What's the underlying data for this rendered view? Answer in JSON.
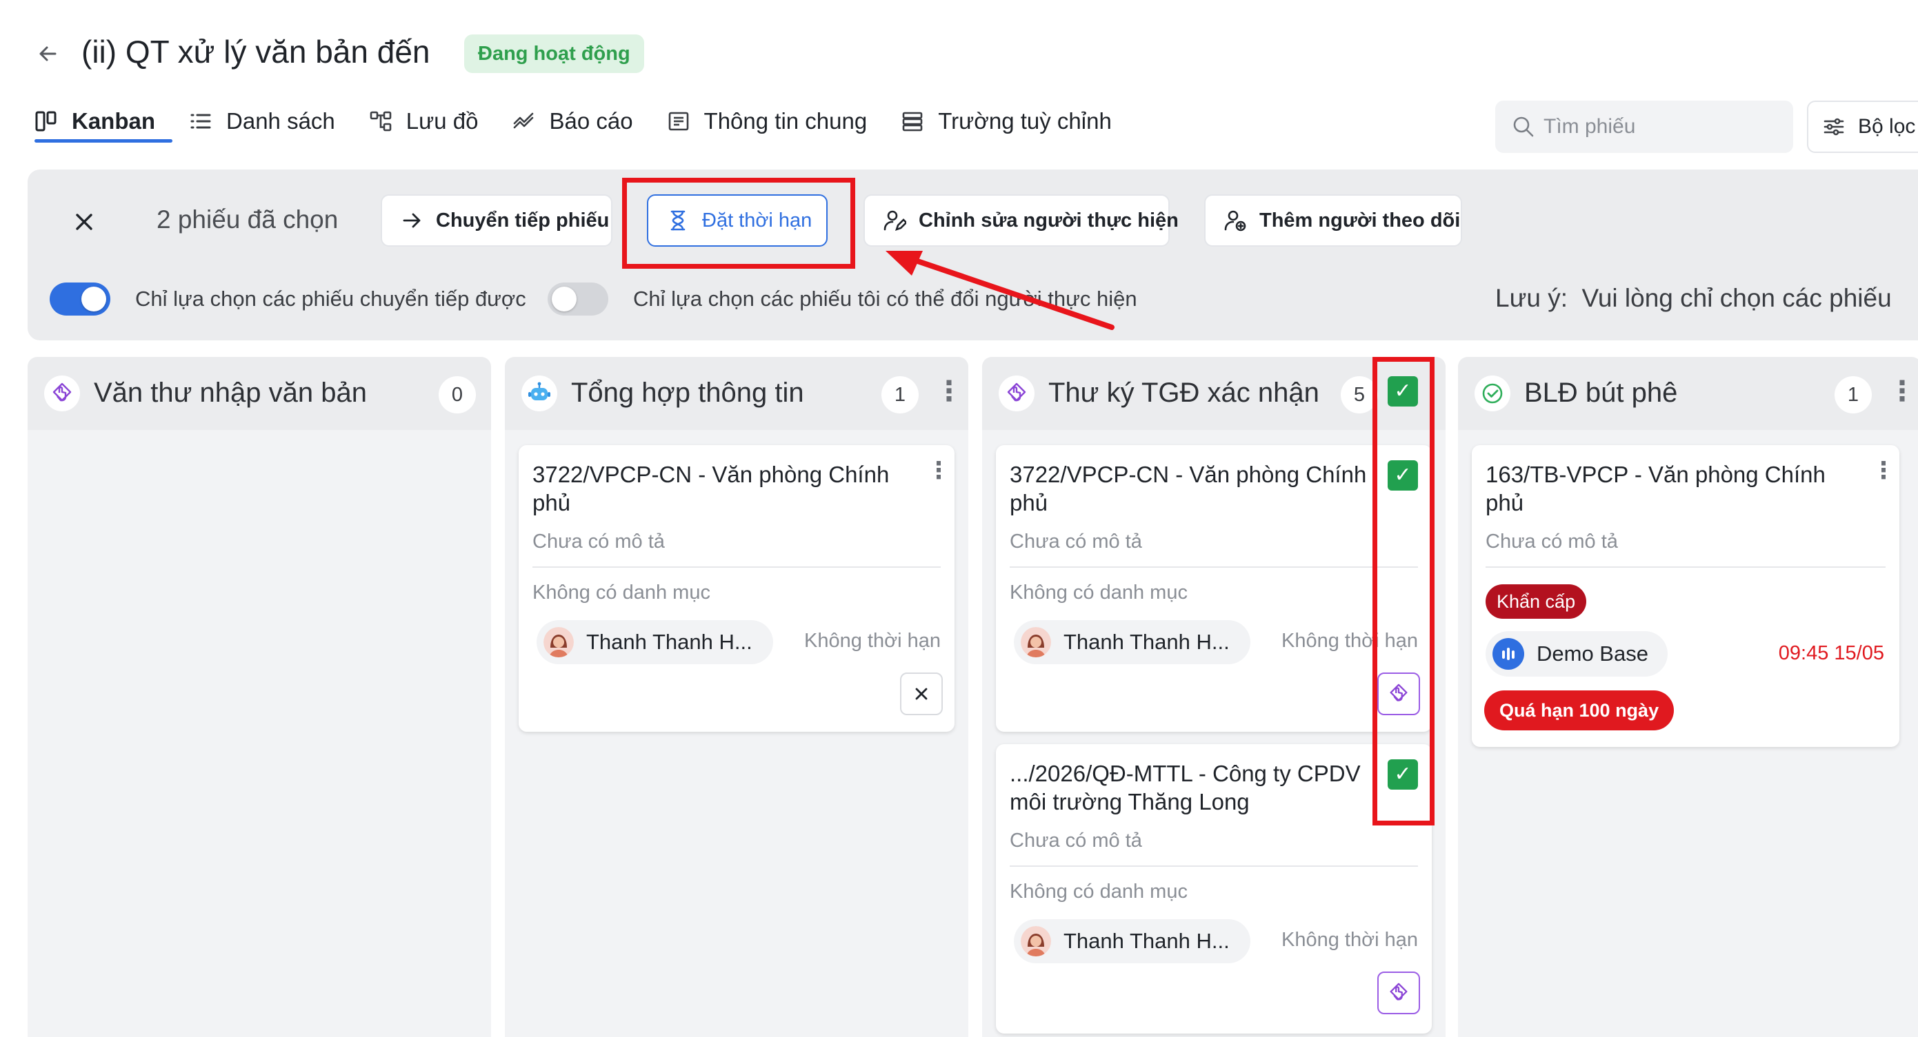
{
  "header": {
    "back_icon": "arrow-left-icon",
    "title": "(ii) QT xử lý văn bản đến",
    "status": "Đang hoạt động",
    "status_color": "#2f9f4d"
  },
  "tabs": [
    {
      "label": "Kanban",
      "icon": "kanban-icon",
      "active": true
    },
    {
      "label": "Danh sách",
      "icon": "list-icon"
    },
    {
      "label": "Lưu đồ",
      "icon": "flowchart-icon"
    },
    {
      "label": "Báo cáo",
      "icon": "report-icon"
    },
    {
      "label": "Thông tin chung",
      "icon": "info-icon"
    },
    {
      "label": "Trường tuỳ chỉnh",
      "icon": "custom-fields-icon"
    }
  ],
  "search": {
    "placeholder": "Tìm phiếu"
  },
  "filter": {
    "label": "Bộ lọc"
  },
  "selection": {
    "count_text": "2 phiếu đã chọn",
    "actions": [
      {
        "label": "Chuyển tiếp phiếu",
        "icon": "arrow-right-icon"
      },
      {
        "label": "Đặt thời hạn",
        "icon": "hourglass-icon",
        "primary": true
      },
      {
        "label": "Chỉnh sửa người thực hiện",
        "icon": "user-edit-icon"
      },
      {
        "label": "Thêm người theo dõi",
        "icon": "user-follow-icon"
      }
    ],
    "toggle1": {
      "label": "Chỉ lựa chọn các phiếu chuyển tiếp được",
      "on": true
    },
    "toggle2": {
      "label": "Chỉ lựa chọn các phiếu tôi có thể đổi người thực hiện",
      "on": false
    },
    "note_label": "Lưu ý:",
    "note_text": "Vui lòng chỉ chọn các phiếu"
  },
  "accent_color": "#2f6fe0",
  "annotation_color": "#e8151b",
  "columns": [
    {
      "title": "Văn thư nhập văn bản",
      "count": "0",
      "icon": "step-hand-icon",
      "cards": []
    },
    {
      "title": "Tổng hợp thông tin",
      "count": "1",
      "icon": "robot-icon",
      "cards": [
        {
          "title": "3722/VPCP-CN - Văn phòng Chính phủ",
          "description": "Chưa có mô tả",
          "category": "Không có danh mục",
          "assignee": "Thanh Thanh H...",
          "deadline": "Không thời hạn"
        }
      ]
    },
    {
      "title": "Thư ký TGĐ xác nhận",
      "count": "5",
      "icon": "step-hand-icon",
      "cards": [
        {
          "title": "3722/VPCP-CN - Văn phòng Chính phủ",
          "description": "Chưa có mô tả",
          "category": "Không có danh mục",
          "assignee": "Thanh Thanh H...",
          "deadline": "Không thời hạn",
          "checked": true
        },
        {
          "title": ".../2026/QĐ-MTTL - Công ty CPDV môi trường Thăng Long",
          "description": "Chưa có mô tả",
          "category": "Không có danh mục",
          "assignee": "Thanh Thanh H...",
          "deadline": "Không thời hạn",
          "checked": true
        }
      ]
    },
    {
      "title": "BLĐ bút phê",
      "count": "1",
      "icon": "check-circle-icon",
      "cards": [
        {
          "title": "163/TB-VPCP - Văn phòng Chính phủ",
          "description": "Chưa có mô tả",
          "tag": "Khẩn cấp",
          "organization": "Demo Base",
          "time": "09:45 15/05",
          "overdue": "Quá hạn 100 ngày"
        }
      ]
    }
  ]
}
